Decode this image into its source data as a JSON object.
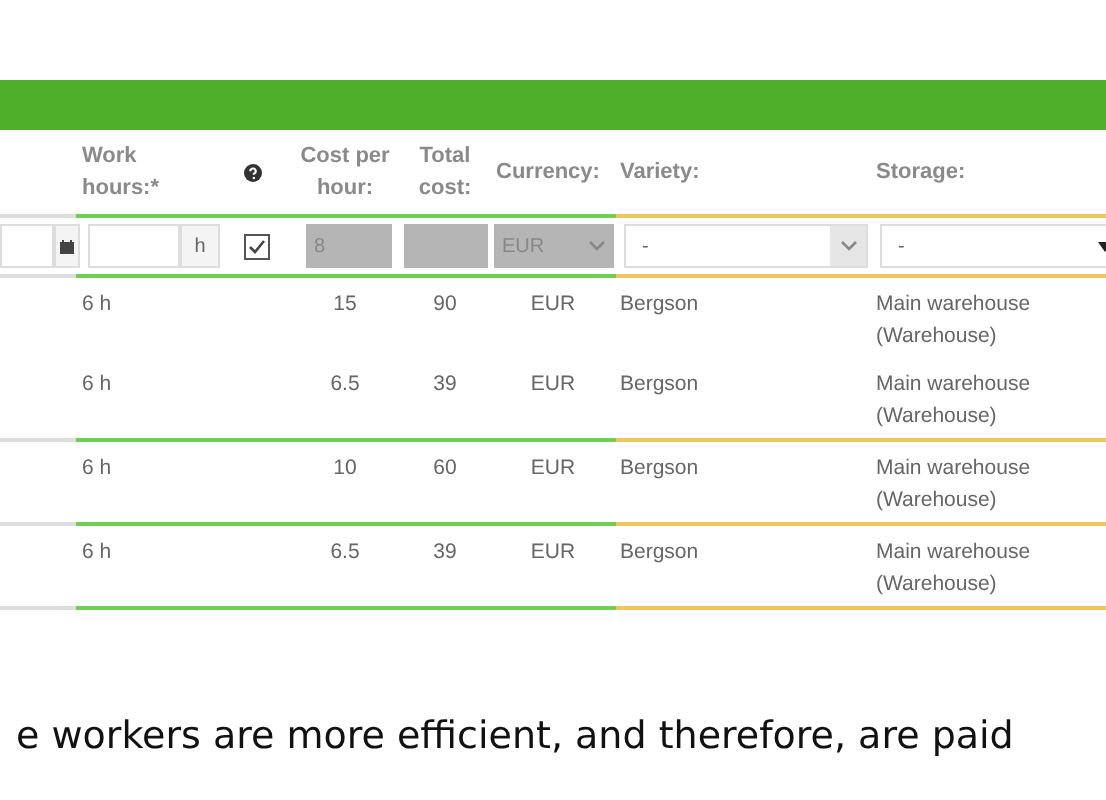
{
  "columns": [
    "Work hours:*",
    "Cost per hour:",
    "Total cost:",
    "Currency:",
    "Variety:",
    "Storage:"
  ],
  "filter_row": {
    "hours_unit": "h",
    "checked": true,
    "cost_per_hour": "8",
    "currency": "EUR",
    "variety": "-",
    "storage": "-"
  },
  "row_groups": [
    {
      "rows": [
        {
          "hours": "6 h",
          "cost": "15",
          "total": "90",
          "currency": "EUR",
          "variety": "Bergson",
          "storage": "Main warehouse (Warehouse)"
        },
        {
          "hours": "6 h",
          "cost": "6.5",
          "total": "39",
          "currency": "EUR",
          "variety": "Bergson",
          "storage": "Main warehouse (Warehouse)"
        }
      ]
    },
    {
      "rows": [
        {
          "hours": "6 h",
          "cost": "10",
          "total": "60",
          "currency": "EUR",
          "variety": "Bergson",
          "storage": "Main warehouse (Warehouse)"
        }
      ]
    },
    {
      "rows": [
        {
          "hours": "6 h",
          "cost": "6.5",
          "total": "39",
          "currency": "EUR",
          "variety": "Bergson",
          "storage": "Main warehouse (Warehouse)"
        }
      ]
    }
  ],
  "caption": "e workers are more efficient, and therefore, are paid"
}
